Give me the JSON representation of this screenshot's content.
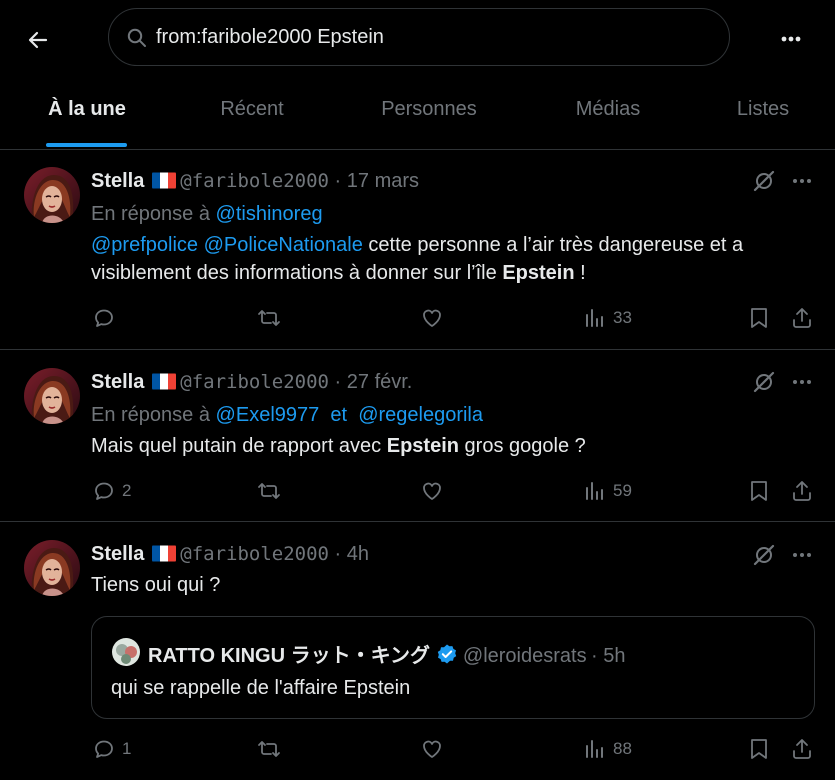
{
  "search": {
    "query": "from:faribole2000 Epstein"
  },
  "tabs": [
    {
      "label": "À la une",
      "active": true
    },
    {
      "label": "Récent"
    },
    {
      "label": "Personnes"
    },
    {
      "label": "Médias"
    },
    {
      "label": "Listes"
    }
  ],
  "tweets": [
    {
      "name": "Stella",
      "handle": "@faribole2000",
      "time": "· 17 mars",
      "reply_prefix": "En réponse à",
      "reply_to_1": "@tishinoreg",
      "mention_1": "@prefpolice",
      "mention_2": "@PoliceNationale",
      "text_1": " cette personne a l’air très dangereuse et a",
      "text_2": "visiblement des informations à donner sur l’île ",
      "keyword": "Epstein",
      "text_3": " !",
      "replies": "",
      "views": "33"
    },
    {
      "name": "Stella",
      "handle": "@faribole2000",
      "time": "· 27 févr.",
      "reply_prefix": "En réponse à",
      "reply_to_1": "@Exel9977",
      "reply_and": "et",
      "reply_to_2": "@regelegorila",
      "text_1": "Mais quel putain de rapport avec ",
      "keyword": "Epstein",
      "text_2": " gros gogole ?",
      "replies": "2",
      "views": "59"
    },
    {
      "name": "Stella",
      "handle": "@faribole2000",
      "time": "· 4h",
      "text_1": "Tiens oui qui ?",
      "replies": "1",
      "views": "88",
      "quote": {
        "name": "RATTO KINGU ラット・キング",
        "handle": "@leroidesrats",
        "time": "· 5h",
        "text": "qui se rappelle de l'affaire Epstein"
      }
    }
  ],
  "colors": {
    "accent": "#1d9bf0",
    "muted": "#71767b",
    "border": "#2f3336",
    "text": "#e7e9ea"
  }
}
